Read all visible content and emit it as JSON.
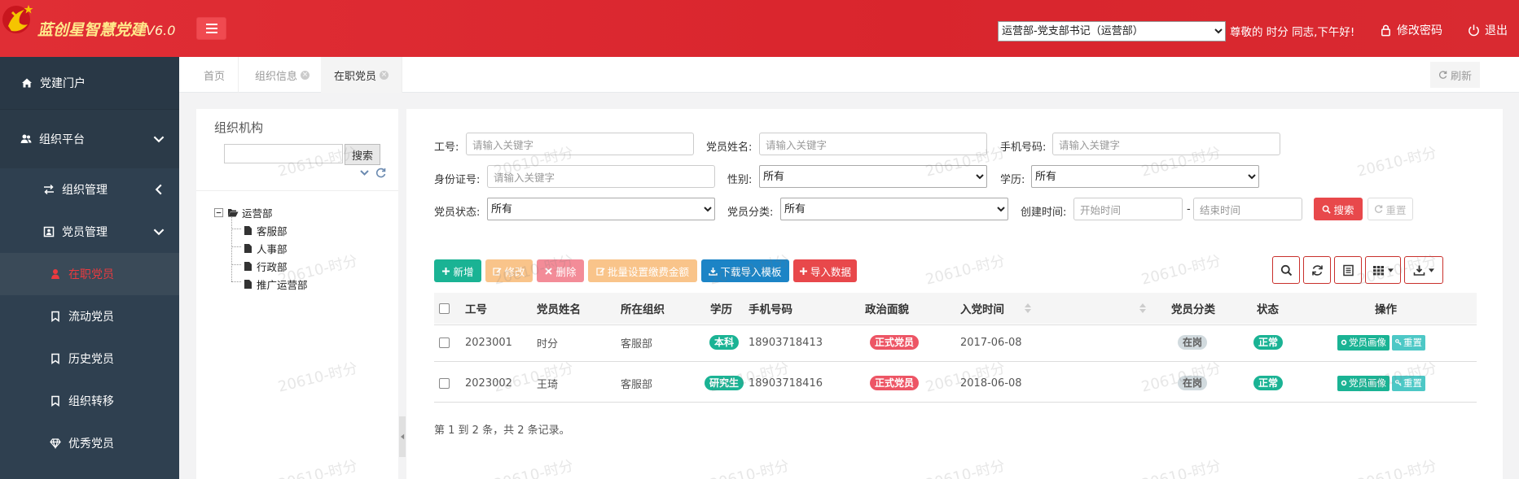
{
  "app": {
    "title": "蓝创星智慧党建",
    "version": "V6.0"
  },
  "header": {
    "role_selected": "运营部-党支部书记（运营部）",
    "greeting": "尊敬的 时分 同志,下午好!",
    "change_password": "修改密码",
    "logout": "退出"
  },
  "sidebar": {
    "portal": "党建门户",
    "org_platform": "组织平台",
    "items": [
      {
        "label": "组织管理",
        "icon": "exchange-icon"
      },
      {
        "label": "党员管理",
        "icon": "id-card-icon"
      },
      {
        "label": "在职党员",
        "icon": "user-icon"
      },
      {
        "label": "流动党员",
        "icon": "bookmark-icon"
      },
      {
        "label": "历史党员",
        "icon": "bookmark-icon"
      },
      {
        "label": "组织转移",
        "icon": "bookmark-icon"
      },
      {
        "label": "优秀党员",
        "icon": "diamond-icon"
      }
    ]
  },
  "tabs": {
    "home": "首页",
    "org_info": "组织信息",
    "active_members": "在职党员",
    "refresh": "刷新"
  },
  "left_panel": {
    "title": "组织机构",
    "search_button": "搜索",
    "tree_root": "运营部",
    "tree_children": [
      "客服部",
      "人事部",
      "行政部",
      "推广运营部"
    ]
  },
  "filters": {
    "emp_no_label": "工号:",
    "emp_no_placeholder": "请输入关键字",
    "name_label": "党员姓名:",
    "name_placeholder": "请输入关键字",
    "phone_label": "手机号码:",
    "phone_placeholder": "请输入关键字",
    "id_label": "身份证号:",
    "id_placeholder": "请输入关键字",
    "gender_label": "性别:",
    "gender_value": "所有",
    "edu_label": "学历:",
    "edu_value": "所有",
    "status_label": "党员状态:",
    "status_value": "所有",
    "category_label": "党员分类:",
    "category_value": "所有",
    "created_label": "创建时间:",
    "start_placeholder": "开始时间",
    "dash": "-",
    "end_placeholder": "结束时间",
    "search_button": "搜索",
    "reset_button": "重置"
  },
  "toolbar": {
    "add": "新增",
    "edit": "修改",
    "delete": "删除",
    "batch_fee": "批量设置缴费金额",
    "download_template": "下载导入模板",
    "import": "导入数据"
  },
  "table": {
    "headers": [
      "工号",
      "党员姓名",
      "所在组织",
      "学历",
      "手机号码",
      "政治面貌",
      "入党时间",
      "党员分类",
      "状态",
      "操作"
    ],
    "rows": [
      {
        "emp_no": "2023001",
        "name": "时分",
        "org": "客服部",
        "edu": "本科",
        "phone": "18903718413",
        "political": "正式党员",
        "join_date": "2017-06-08",
        "category": "在岗",
        "status": "正常",
        "action_portrait": "党员画像",
        "action_reset": "重置"
      },
      {
        "emp_no": "2023002",
        "name": "王琦",
        "org": "客服部",
        "edu": "研究生",
        "phone": "18903718416",
        "political": "正式党员",
        "join_date": "2018-06-08",
        "category": "在岗",
        "status": "正常",
        "action_portrait": "党员画像",
        "action_reset": "重置"
      }
    ]
  },
  "pager": {
    "summary": "第 1 到 2 条，共 2 条记录。"
  },
  "watermark": "20610-时分",
  "colors": {
    "header_red": "#d9252d",
    "sidebar_bg": "#2f4050",
    "btn_add": "#1ab394",
    "btn_edit": "#f8ac59",
    "btn_delete": "#ed5565",
    "btn_blue": "#1c84c6",
    "btn_red": "#d9534f",
    "badge_green": "#1ab394",
    "badge_red": "#ed5565"
  }
}
